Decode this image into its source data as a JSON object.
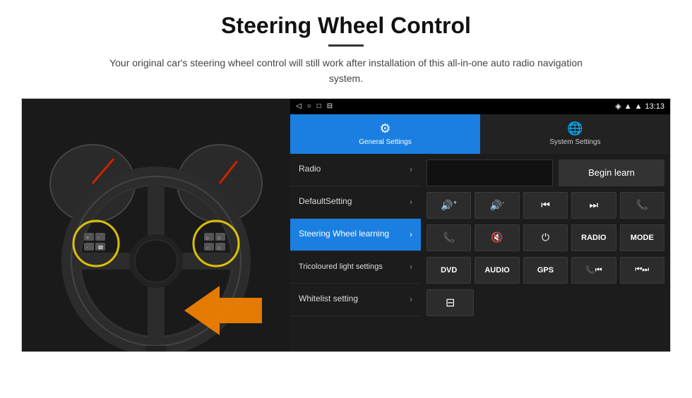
{
  "page": {
    "title": "Steering Wheel Control",
    "subtitle": "Your original car's steering wheel control will still work after installation of this all-in-one auto radio navigation system."
  },
  "status_bar": {
    "time": "13:13",
    "nav_icons": [
      "◁",
      "○",
      "□",
      "⊟"
    ]
  },
  "tabs": [
    {
      "id": "general",
      "label": "General Settings",
      "icon": "⚙",
      "active": true
    },
    {
      "id": "system",
      "label": "System Settings",
      "icon": "🌐",
      "active": false
    }
  ],
  "menu_items": [
    {
      "id": "radio",
      "label": "Radio",
      "active": false
    },
    {
      "id": "default",
      "label": "DefaultSetting",
      "active": false
    },
    {
      "id": "steering",
      "label": "Steering Wheel learning",
      "active": true
    },
    {
      "id": "tricoloured",
      "label": "Tricoloured light settings",
      "active": false
    },
    {
      "id": "whitelist",
      "label": "Whitelist setting",
      "active": false
    }
  ],
  "control_panel": {
    "begin_learn_label": "Begin learn",
    "buttons_row1": [
      "🔊+",
      "🔊-",
      "⏮",
      "⏭",
      "📞"
    ],
    "buttons_row2": [
      "📞↩",
      "🔇",
      "⏻",
      "RADIO",
      "MODE"
    ],
    "buttons_row3": [
      "DVD",
      "AUDIO",
      "GPS",
      "📞⏮",
      "⏮⏭"
    ],
    "buttons_row4": [
      "⊟"
    ]
  }
}
